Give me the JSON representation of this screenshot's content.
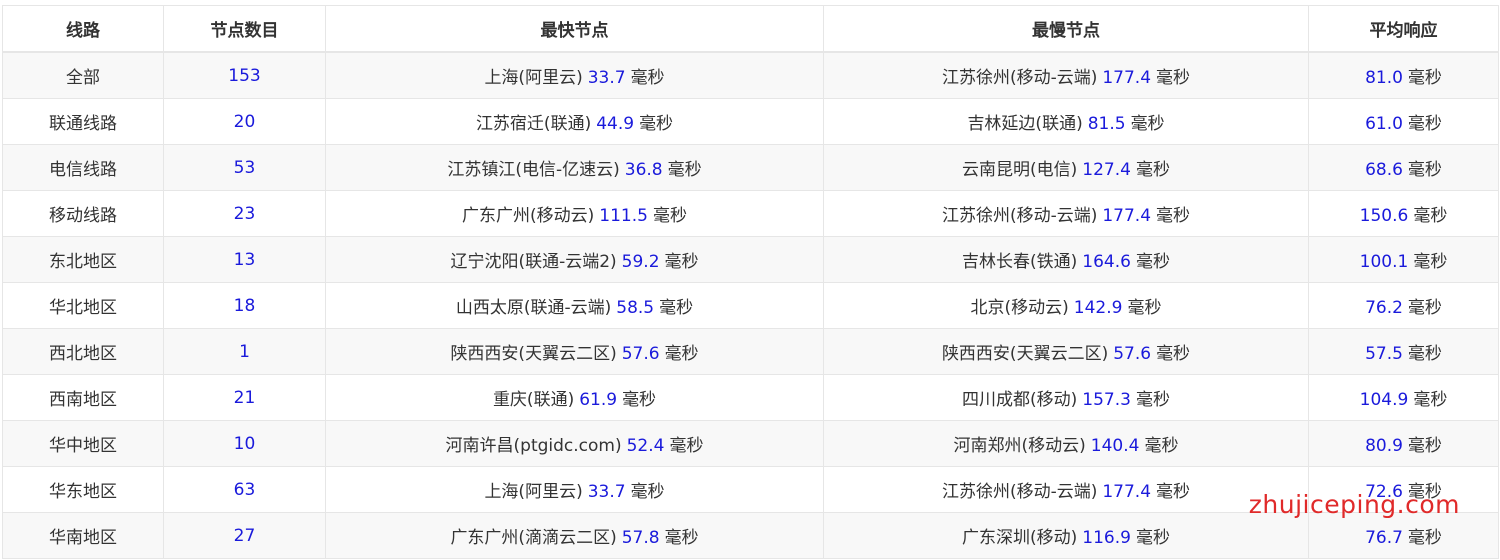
{
  "table": {
    "headers": [
      "线路",
      "节点数目",
      "最快节点",
      "最慢节点",
      "平均响应"
    ],
    "unit": "毫秒",
    "rows": [
      {
        "line": "全部",
        "count": "153",
        "fast_node": "上海(阿里云)",
        "fast_ms": "33.7",
        "slow_node": "江苏徐州(移动-云端)",
        "slow_ms": "177.4",
        "avg_ms": "81.0"
      },
      {
        "line": "联通线路",
        "count": "20",
        "fast_node": "江苏宿迁(联通)",
        "fast_ms": "44.9",
        "slow_node": "吉林延边(联通)",
        "slow_ms": "81.5",
        "avg_ms": "61.0"
      },
      {
        "line": "电信线路",
        "count": "53",
        "fast_node": "江苏镇江(电信-亿速云)",
        "fast_ms": "36.8",
        "slow_node": "云南昆明(电信)",
        "slow_ms": "127.4",
        "avg_ms": "68.6"
      },
      {
        "line": "移动线路",
        "count": "23",
        "fast_node": "广东广州(移动云)",
        "fast_ms": "111.5",
        "slow_node": "江苏徐州(移动-云端)",
        "slow_ms": "177.4",
        "avg_ms": "150.6"
      },
      {
        "line": "东北地区",
        "count": "13",
        "fast_node": "辽宁沈阳(联通-云端2)",
        "fast_ms": "59.2",
        "slow_node": "吉林长春(铁通)",
        "slow_ms": "164.6",
        "avg_ms": "100.1"
      },
      {
        "line": "华北地区",
        "count": "18",
        "fast_node": "山西太原(联通-云端)",
        "fast_ms": "58.5",
        "slow_node": "北京(移动云)",
        "slow_ms": "142.9",
        "avg_ms": "76.2"
      },
      {
        "line": "西北地区",
        "count": "1",
        "fast_node": "陕西西安(天翼云二区)",
        "fast_ms": "57.6",
        "slow_node": "陕西西安(天翼云二区)",
        "slow_ms": "57.6",
        "avg_ms": "57.5"
      },
      {
        "line": "西南地区",
        "count": "21",
        "fast_node": "重庆(联通)",
        "fast_ms": "61.9",
        "slow_node": "四川成都(移动)",
        "slow_ms": "157.3",
        "avg_ms": "104.9"
      },
      {
        "line": "华中地区",
        "count": "10",
        "fast_node": "河南许昌(ptgidc.com)",
        "fast_ms": "52.4",
        "slow_node": "河南郑州(移动云)",
        "slow_ms": "140.4",
        "avg_ms": "80.9"
      },
      {
        "line": "华东地区",
        "count": "63",
        "fast_node": "上海(阿里云)",
        "fast_ms": "33.7",
        "slow_node": "江苏徐州(移动-云端)",
        "slow_ms": "177.4",
        "avg_ms": "72.6"
      },
      {
        "line": "华南地区",
        "count": "27",
        "fast_node": "广东广州(滴滴云二区)",
        "fast_ms": "57.8",
        "slow_node": "广东深圳(移动)",
        "slow_ms": "116.9",
        "avg_ms": "76.7"
      }
    ]
  },
  "watermark": "zhujiceping.com"
}
